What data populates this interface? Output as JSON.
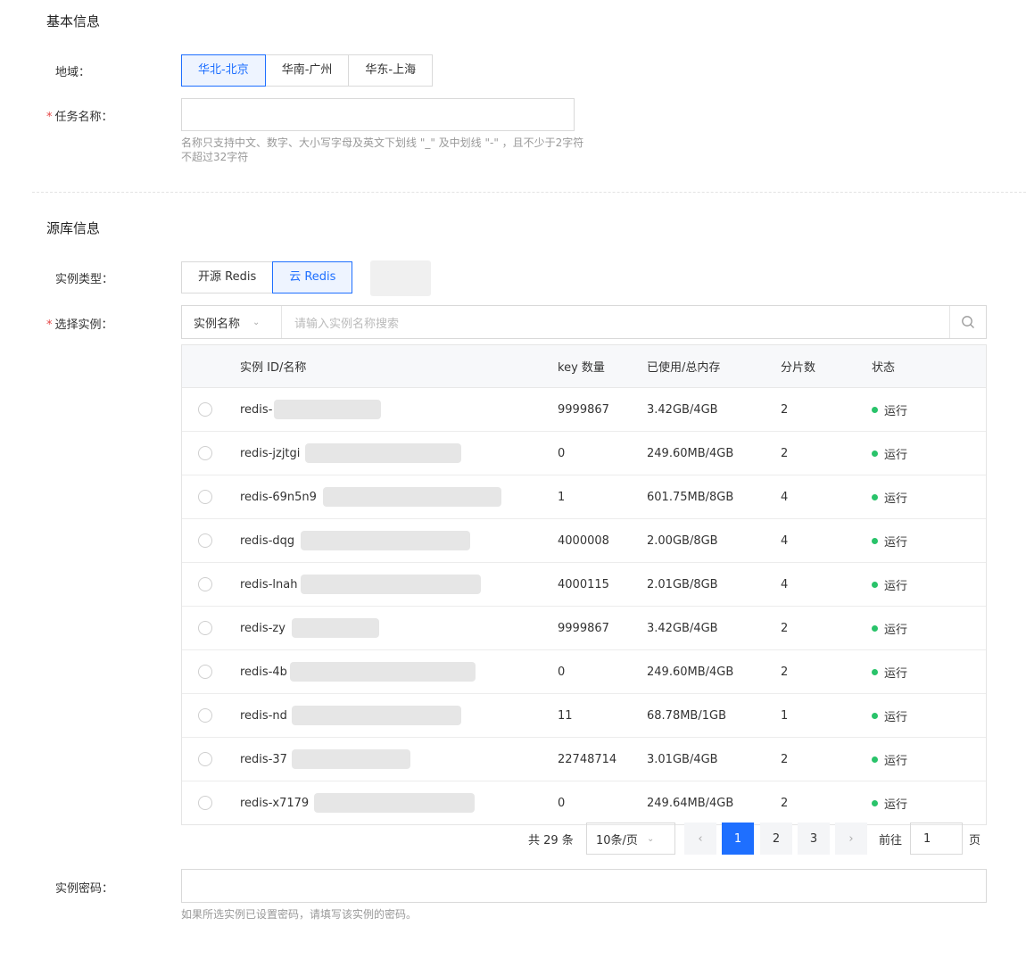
{
  "basic": {
    "title": "基本信息",
    "region_label": "地域：",
    "regions": [
      "华北-北京",
      "华南-广州",
      "华东-上海"
    ],
    "task_label": "任务名称：",
    "task_value": "",
    "task_help_1": "名称只支持中文、数字、大小写字母及英文下划线 \"_\" 及中划线 \"-\" ，且不少于2字符",
    "task_help_2": "不超过32字符"
  },
  "source": {
    "title": "源库信息",
    "type_label": "实例类型：",
    "types": [
      "开源 Redis",
      "云 Redis"
    ],
    "select_label": "选择实例：",
    "filter_field": "实例名称",
    "search_placeholder": "请输入实例名称搜索"
  },
  "table": {
    "headers": [
      "实例 ID/名称",
      "key 数量",
      "已使用/总内存",
      "分片数",
      "状态"
    ],
    "rows": [
      {
        "id": "redis-",
        "keys": "9999867",
        "mem": "3.42GB/4GB",
        "shards": "2",
        "status": "运行"
      },
      {
        "id": "redis-jzjtgi",
        "keys": "0",
        "mem": "249.60MB/4GB",
        "shards": "2",
        "status": "运行"
      },
      {
        "id": "redis-69n5n9",
        "keys": "1",
        "mem": "601.75MB/8GB",
        "shards": "4",
        "status": "运行"
      },
      {
        "id": "redis-dqg",
        "keys": "4000008",
        "mem": "2.00GB/8GB",
        "shards": "4",
        "status": "运行"
      },
      {
        "id": "redis-lnah",
        "keys": "4000115",
        "mem": "2.01GB/8GB",
        "shards": "4",
        "status": "运行"
      },
      {
        "id": "redis-zy",
        "keys": "9999867",
        "mem": "3.42GB/4GB",
        "shards": "2",
        "status": "运行"
      },
      {
        "id": "redis-4b",
        "keys": "0",
        "mem": "249.60MB/4GB",
        "shards": "2",
        "status": "运行"
      },
      {
        "id": "redis-nd",
        "keys": "11",
        "mem": "68.78MB/1GB",
        "shards": "1",
        "status": "运行"
      },
      {
        "id": "redis-37",
        "keys": "22748714",
        "mem": "3.01GB/4GB",
        "shards": "2",
        "status": "运行"
      },
      {
        "id": "redis-x7179",
        "keys": "0",
        "mem": "249.64MB/4GB",
        "shards": "2",
        "status": "运行"
      }
    ]
  },
  "pagination": {
    "total": "共 29 条",
    "page_size": "10条/页",
    "pages": [
      "1",
      "2",
      "3"
    ],
    "goto_label": "前往",
    "goto_value": "1",
    "page_suffix": "页"
  },
  "password": {
    "label": "实例密码：",
    "value": "",
    "help": "如果所选实例已设置密码，请填写该实例的密码。"
  },
  "colors": {
    "accent": "#1e6fff",
    "running": "#29c36a",
    "required": "#e54545"
  }
}
